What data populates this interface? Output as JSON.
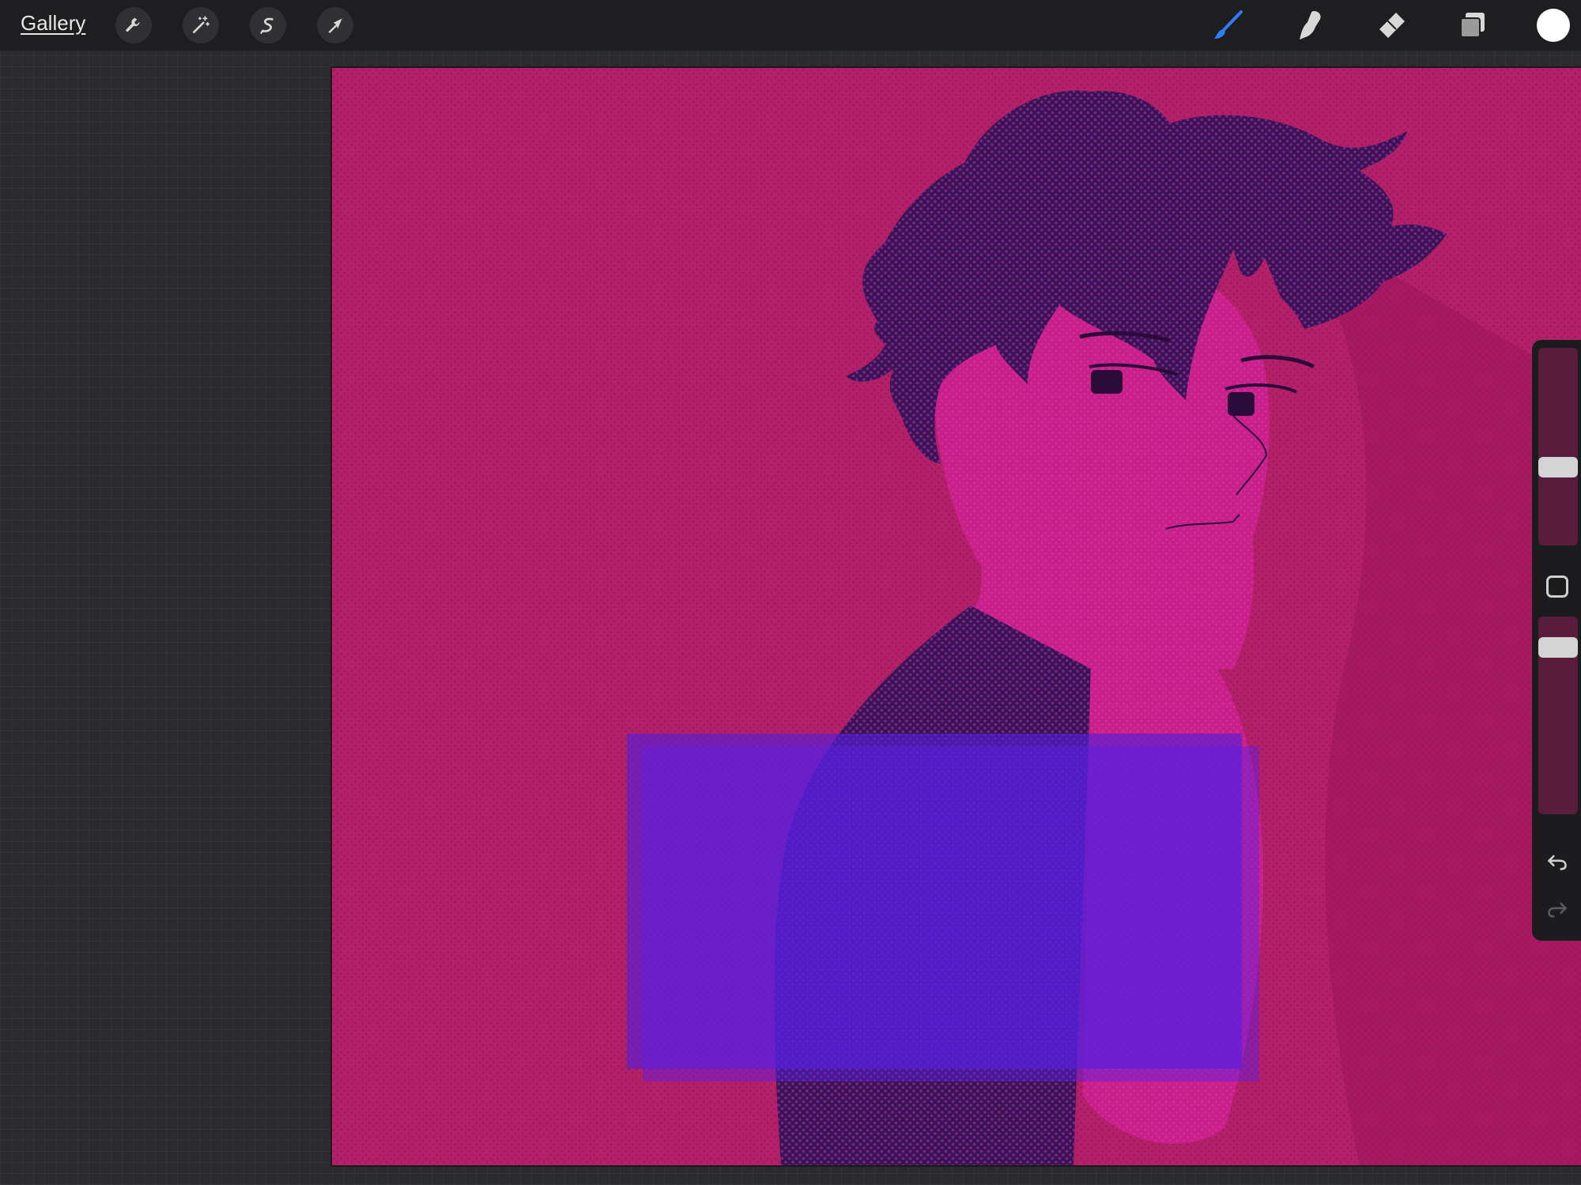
{
  "toolbar": {
    "gallery_label": "Gallery",
    "left_tools": [
      {
        "name": "actions",
        "icon": "wrench-icon"
      },
      {
        "name": "adjustments",
        "icon": "magic-wand-icon"
      },
      {
        "name": "selection",
        "icon": "selection-s-icon"
      },
      {
        "name": "transform",
        "icon": "arrow-cursor-icon"
      }
    ],
    "right_tools": [
      {
        "name": "brush",
        "icon": "brush-icon",
        "active": true
      },
      {
        "name": "smudge",
        "icon": "smudge-finger-icon"
      },
      {
        "name": "eraser",
        "icon": "eraser-icon"
      },
      {
        "name": "layers",
        "icon": "layers-icon"
      }
    ],
    "current_color": "#ffffff",
    "active_color": "#2f7cf6"
  },
  "sidebar": {
    "brush_size_level": 0.6,
    "brush_opacity_level": 0.95,
    "undo_icon": "undo-icon",
    "redo_icon": "redo-icon",
    "modify_icon": "square-modify-icon"
  },
  "canvas": {
    "background_color": "#b5206a",
    "hair_color": "#3a1450",
    "skin_color": "#c81f8a",
    "overlay_color": "#5a1ed4"
  }
}
